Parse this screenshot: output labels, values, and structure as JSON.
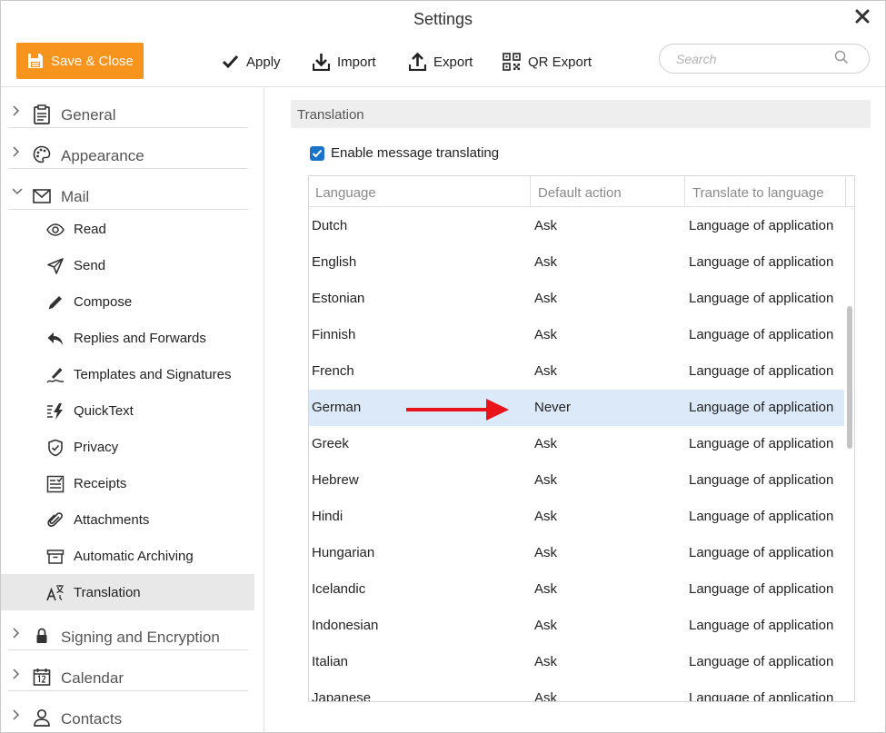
{
  "window": {
    "title": "Settings"
  },
  "toolbar": {
    "save_close": "Save & Close",
    "apply": "Apply",
    "import": "Import",
    "export": "Export",
    "qr_export": "QR Export",
    "search_placeholder": "Search"
  },
  "colors": {
    "accent": "#f7941d",
    "checkbox": "#1a73c9",
    "selected_row": "#dbe9f8",
    "arrow": "#e8141a"
  },
  "sidebar": {
    "sections": [
      {
        "label": "General",
        "icon": "clipboard-icon",
        "expanded": false
      },
      {
        "label": "Appearance",
        "icon": "palette-icon",
        "expanded": false
      },
      {
        "label": "Mail",
        "icon": "envelope-icon",
        "expanded": true
      },
      {
        "label": "Signing and Encryption",
        "icon": "lock-icon",
        "expanded": false
      },
      {
        "label": "Calendar",
        "icon": "calendar-icon",
        "expanded": false
      },
      {
        "label": "Contacts",
        "icon": "person-icon",
        "expanded": false
      }
    ],
    "mail_items": [
      {
        "label": "Read",
        "icon": "eye-icon"
      },
      {
        "label": "Send",
        "icon": "paper-plane-icon"
      },
      {
        "label": "Compose",
        "icon": "pencil-icon"
      },
      {
        "label": "Replies and Forwards",
        "icon": "reply-icon"
      },
      {
        "label": "Templates and Signatures",
        "icon": "signature-icon"
      },
      {
        "label": "QuickText",
        "icon": "lightning-icon"
      },
      {
        "label": "Privacy",
        "icon": "shield-icon"
      },
      {
        "label": "Receipts",
        "icon": "receipt-icon"
      },
      {
        "label": "Attachments",
        "icon": "paperclip-icon"
      },
      {
        "label": "Automatic Archiving",
        "icon": "archive-icon"
      },
      {
        "label": "Translation",
        "icon": "translate-icon",
        "active": true
      }
    ]
  },
  "main": {
    "section_title": "Translation",
    "enable_label": "Enable message translating",
    "enable_checked": true,
    "table": {
      "columns": [
        "Language",
        "Default action",
        "Translate to language"
      ],
      "rows": [
        [
          "Dutch",
          "Ask",
          "Language of application"
        ],
        [
          "English",
          "Ask",
          "Language of application"
        ],
        [
          "Estonian",
          "Ask",
          "Language of application"
        ],
        [
          "Finnish",
          "Ask",
          "Language of application"
        ],
        [
          "French",
          "Ask",
          "Language of application"
        ],
        [
          "German",
          "Never",
          "Language of application"
        ],
        [
          "Greek",
          "Ask",
          "Language of application"
        ],
        [
          "Hebrew",
          "Ask",
          "Language of application"
        ],
        [
          "Hindi",
          "Ask",
          "Language of application"
        ],
        [
          "Hungarian",
          "Ask",
          "Language of application"
        ],
        [
          "Icelandic",
          "Ask",
          "Language of application"
        ],
        [
          "Indonesian",
          "Ask",
          "Language of application"
        ],
        [
          "Italian",
          "Ask",
          "Language of application"
        ],
        [
          "Japanese",
          "Ask",
          "Language of application"
        ]
      ],
      "selected_row": 5
    }
  }
}
